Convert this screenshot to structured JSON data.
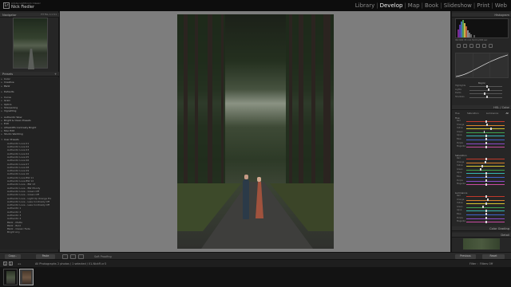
{
  "app": {
    "identity_line1": "Adobe Lightroom Classic",
    "identity_line2": "Nick Fiedler",
    "modules": [
      "Library",
      "Develop",
      "Map",
      "Book",
      "Slideshow",
      "Print",
      "Web"
    ],
    "active_module": "Develop"
  },
  "left": {
    "navigator_label": "Navigator",
    "navigator_zoom": "FIT  FILL  1:1  3:1",
    "presets_label": "Presets",
    "preset_items": [
      {
        "label": "Color",
        "group": true
      },
      {
        "label": "Creative",
        "group": true
      },
      {
        "label": "B&W",
        "group": true
      },
      {
        "gap": true
      },
      {
        "label": "Defaults",
        "group": true
      },
      {
        "gap": true
      },
      {
        "label": "Curve",
        "group": true
      },
      {
        "label": "Grain",
        "group": true
      },
      {
        "label": "Optics",
        "group": true
      },
      {
        "label": "Sharpening",
        "group": true
      },
      {
        "label": "Vignetting",
        "group": true
      },
      {
        "gap": true
      },
      {
        "label": "Authentic Wow",
        "group": true
      },
      {
        "label": "Bright & Clean Presets",
        "group": true
      },
      {
        "label": "Edit",
        "group": true
      },
      {
        "label": "LEGACIES Contrasty Bright",
        "group": true
      },
      {
        "label": "Moo Edit",
        "group": true
      },
      {
        "label": "Studio Wedding",
        "group": true
      },
      {
        "gap": true
      },
      {
        "label": "User Presets",
        "group": true,
        "open": true
      },
      {
        "label": "Authentic Love 01"
      },
      {
        "label": "Authentic Love 02"
      },
      {
        "label": "Authentic Love 03"
      },
      {
        "label": "Authentic Love 04"
      },
      {
        "label": "Authentic Love 05"
      },
      {
        "label": "Authentic Love 06"
      },
      {
        "label": "Authentic Love 07"
      },
      {
        "label": "Authentic Love 08"
      },
      {
        "label": "Authentic Love 09"
      },
      {
        "label": "Authentic Love 10"
      },
      {
        "label": "Authentic Love BW 11"
      },
      {
        "label": "Authentic Love BW 12"
      },
      {
        "label": "Authentic Love - BW 13"
      },
      {
        "label": "Authentic Love - BW Moody"
      },
      {
        "label": "Authentic Love - Green Off"
      },
      {
        "label": "Authentic Love - Green Off"
      },
      {
        "label": "Authentic Love - Light Up Orange Fix"
      },
      {
        "label": "Authentic Love - Less Contrasty Off"
      },
      {
        "label": "Authentic Love - Less Contrasty Off"
      },
      {
        "label": "Authentic 1"
      },
      {
        "label": "Authentic 2"
      },
      {
        "label": "Authentic 3"
      },
      {
        "label": "Authentic 4"
      },
      {
        "label": "B&W - Matte"
      },
      {
        "label": "B&W - Bold"
      },
      {
        "label": "B&W - Classic Fade"
      },
      {
        "label": "Bright Airy"
      }
    ]
  },
  "right": {
    "histogram_label": "Histogram",
    "histogram_info": "ISO 640   35 mm   f/2.8   1/200 sec",
    "original_photo_label": "Original Photo",
    "tone_region_label": "Region",
    "tone_sliders": [
      {
        "label": "Highlights",
        "pos": 0.5
      },
      {
        "label": "Lights",
        "pos": 0.55
      },
      {
        "label": "Darks",
        "pos": 0.45
      },
      {
        "label": "Shadows",
        "pos": 0.5
      }
    ],
    "hsl_label": "HSL / Color",
    "hsl_tabs": [
      "Hue",
      "Saturation",
      "Luminance",
      "All"
    ],
    "hsl_sections": [
      {
        "title": "Hue",
        "rows": [
          {
            "label": "Red",
            "pos": 0.5
          },
          {
            "label": "Orange",
            "pos": 0.52
          },
          {
            "label": "Yellow",
            "pos": 0.62
          },
          {
            "label": "Green",
            "pos": 0.45
          },
          {
            "label": "Aqua",
            "pos": 0.5
          },
          {
            "label": "Blue",
            "pos": 0.5
          },
          {
            "label": "Purple",
            "pos": 0.5
          },
          {
            "label": "Magenta",
            "pos": 0.5
          }
        ]
      },
      {
        "title": "Saturation",
        "rows": [
          {
            "label": "Red",
            "pos": 0.5
          },
          {
            "label": "Orange",
            "pos": 0.48
          },
          {
            "label": "Yellow",
            "pos": 0.4
          },
          {
            "label": "Green",
            "pos": 0.35
          },
          {
            "label": "Aqua",
            "pos": 0.5
          },
          {
            "label": "Blue",
            "pos": 0.5
          },
          {
            "label": "Purple",
            "pos": 0.5
          },
          {
            "label": "Magenta",
            "pos": 0.5
          }
        ]
      },
      {
        "title": "Luminance",
        "rows": [
          {
            "label": "Red",
            "pos": 0.5
          },
          {
            "label": "Orange",
            "pos": 0.55
          },
          {
            "label": "Yellow",
            "pos": 0.5
          },
          {
            "label": "Green",
            "pos": 0.42
          },
          {
            "label": "Aqua",
            "pos": 0.5
          },
          {
            "label": "Blue",
            "pos": 0.5
          },
          {
            "label": "Purple",
            "pos": 0.5
          },
          {
            "label": "Magenta",
            "pos": 0.5
          }
        ]
      }
    ],
    "color_grading_label": "Color Grading",
    "detail_label": "Detail"
  },
  "toolbar": {
    "copy_label": "Copy...",
    "paste_label": "Paste",
    "soft_proofing_label": "Soft Proofing",
    "previous_label": "Previous",
    "reset_label": "Reset"
  },
  "filmstrip": {
    "page_numbers": [
      "1",
      "2"
    ],
    "count_label": "All Photographs",
    "status_label": "2 photos / 1 selected / 01-NickFi.cr3",
    "filter_label": "Filter :",
    "filter_value": "Filters Off"
  },
  "colors": {
    "accent_active": "#f0f0f0",
    "panel_bg": "#262626",
    "center_bg": "#7d7d7d",
    "hue_red": "#c0392b",
    "hue_orange": "#d9822b",
    "hue_yellow": "#d4c430",
    "hue_green": "#3fa34d",
    "hue_aqua": "#34b3b3",
    "hue_blue": "#3f64c9",
    "hue_purple": "#8c4bc9",
    "hue_magenta": "#c94ba0"
  }
}
